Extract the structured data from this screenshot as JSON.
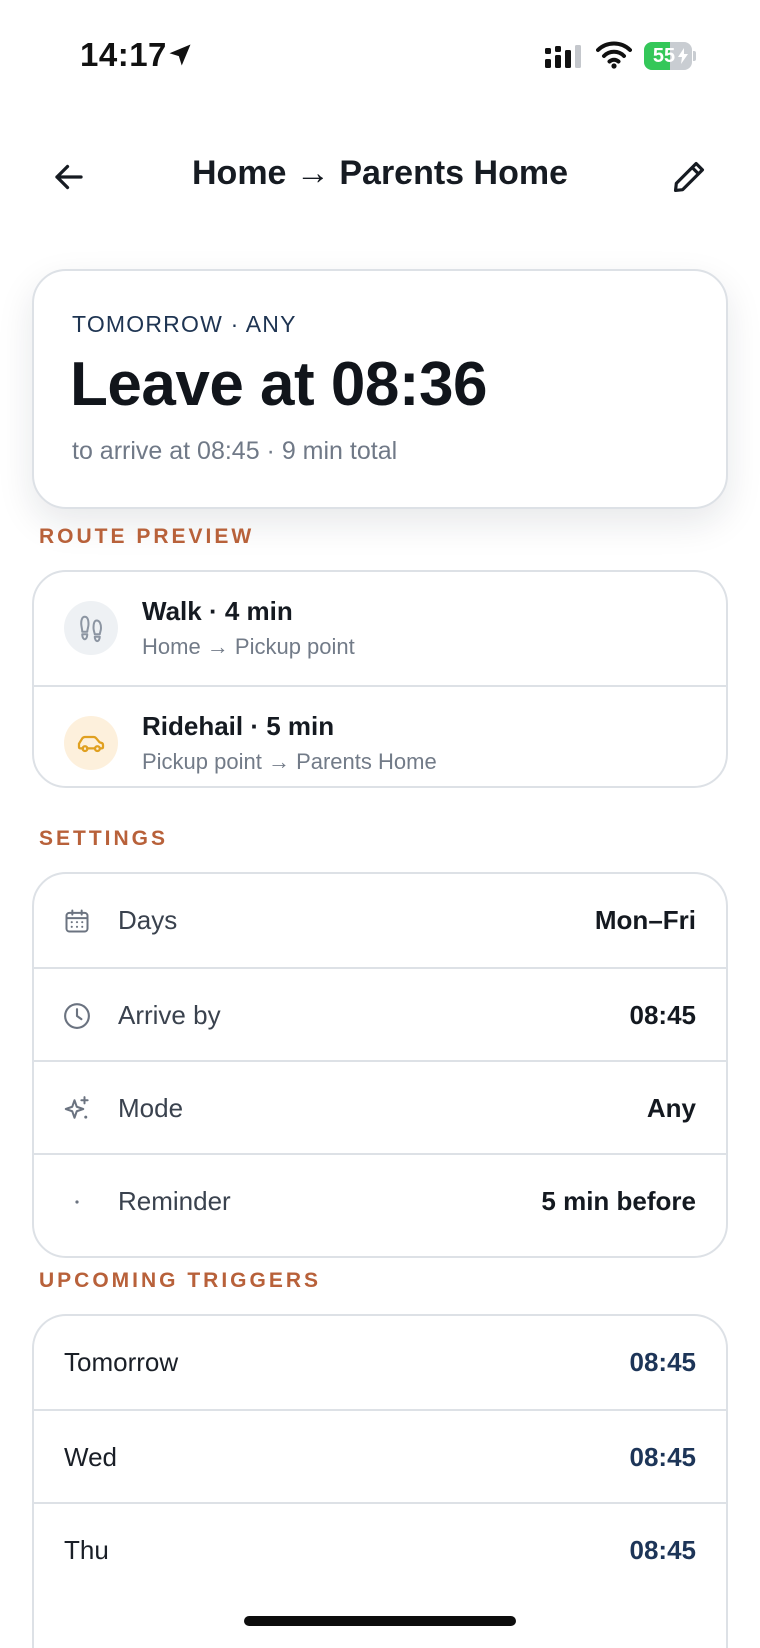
{
  "status_bar": {
    "time": "14:17",
    "battery_level": "55",
    "battery_fraction": 0.55,
    "colors": {
      "battery_green": "#34c759"
    },
    "icons": [
      "location-arrow-icon",
      "cellular-signal-icon",
      "wifi-icon",
      "battery-charging-icon"
    ]
  },
  "header": {
    "title": "Home → Parents Home",
    "icons": [
      "back-arrow-icon",
      "pencil-icon"
    ]
  },
  "hero": {
    "kicker": "TOMORROW · ANY",
    "title": "Leave at 08:36",
    "subtitle": "to arrive at 08:45 · 9 min total"
  },
  "route_preview": {
    "section_label": "ROUTE PREVIEW",
    "steps": [
      {
        "title": "Walk · 4 min",
        "subtitle": "Home → Pickup point",
        "icon": "footprints-icon"
      },
      {
        "title": "Ridehail · 5 min",
        "subtitle": "Pickup point → Parents Home",
        "icon": "car-icon"
      }
    ],
    "colors": {
      "walk_icon": "#8c95a2",
      "ride_icon": "#e0a020"
    }
  },
  "settings": {
    "section_label": "SETTINGS",
    "rows": [
      {
        "label": "Days",
        "value": "Mon–Fri",
        "icon": "calendar-icon"
      },
      {
        "label": "Arrive by",
        "value": "08:45",
        "icon": "clock-icon"
      },
      {
        "label": "Mode",
        "value": "Any",
        "icon": "sparkle-icon"
      },
      {
        "label": "Reminder",
        "value": "5 min before",
        "icon": "dot-icon"
      }
    ]
  },
  "upcoming": {
    "section_label": "UPCOMING TRIGGERS",
    "rows": [
      {
        "label": "Tomorrow",
        "value": "08:45"
      },
      {
        "label": "Wed",
        "value": "08:45"
      },
      {
        "label": "Thu",
        "value": "08:45"
      }
    ]
  },
  "theme": {
    "section_label_color": "#b8613a",
    "trigger_time_color": "#1d3558",
    "border_color": "#dde1e6"
  }
}
